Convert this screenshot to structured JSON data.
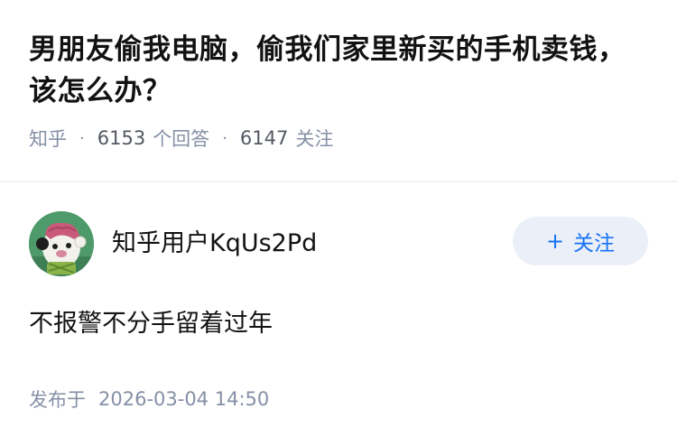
{
  "question": {
    "title": "男朋友偷我电脑，偷我们家里新买的手机卖钱，该怎么办？",
    "source": "知乎",
    "answers_count": "6153",
    "answers_label": "个回答",
    "followers_count": "6147",
    "followers_label": "关注"
  },
  "answer": {
    "author_name": "知乎用户KqUs2Pd",
    "follow_label": "关注",
    "follow_icon": "plus-icon",
    "content": "不报警不分手留着过年",
    "time_label": "发布于",
    "time_value": "2026-03-04 14:50"
  },
  "colors": {
    "accent": "#1772f6",
    "button_bg": "#ebf0f8",
    "meta_gray": "#8590a6",
    "avatar_bg": "#4f9a6a"
  }
}
